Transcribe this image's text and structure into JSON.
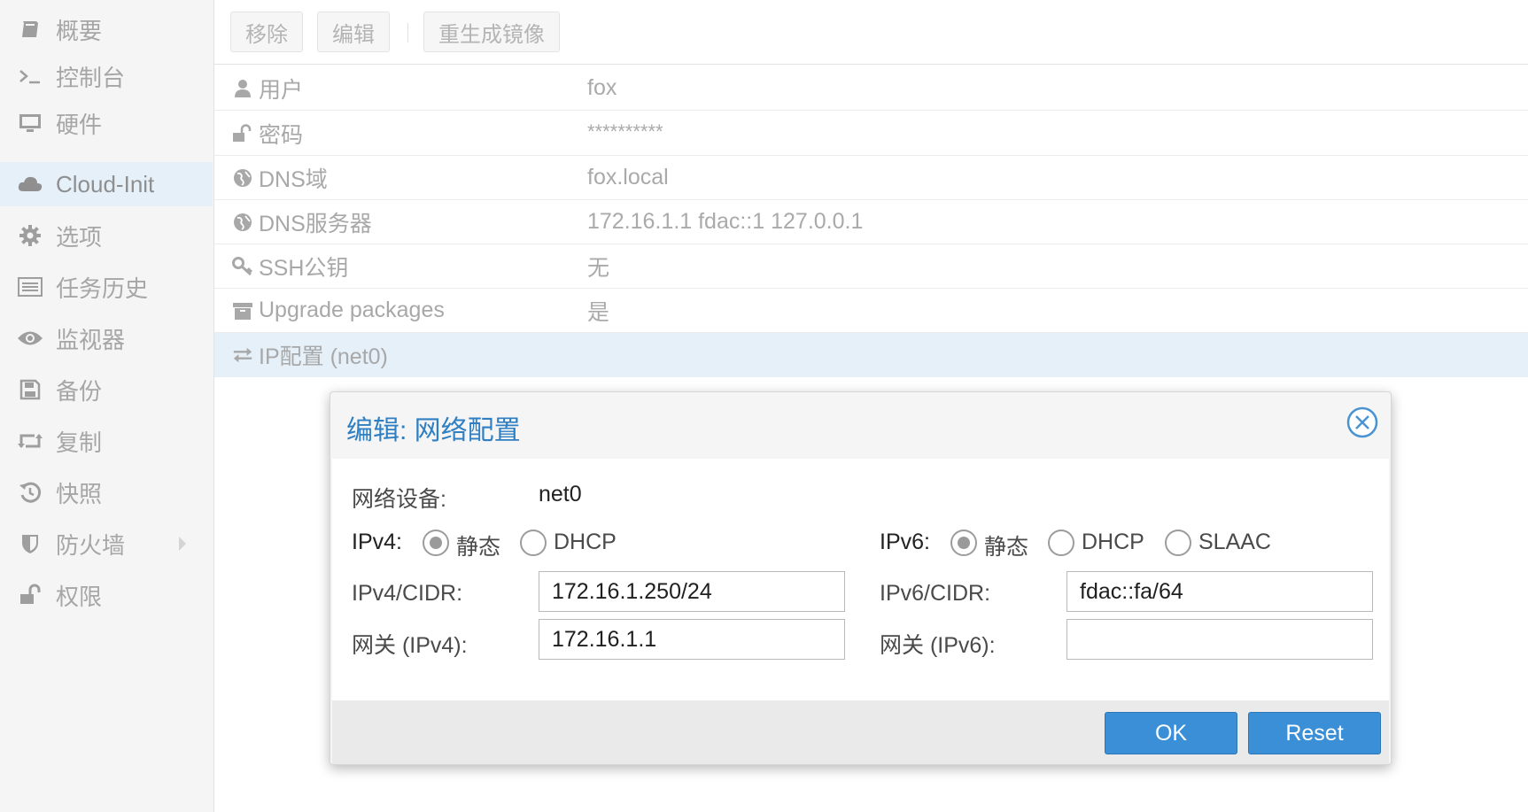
{
  "sidebar": {
    "items": [
      {
        "label": "概要",
        "icon": "book-icon"
      },
      {
        "label": "控制台",
        "icon": "terminal-icon"
      },
      {
        "label": "硬件",
        "icon": "monitor-icon"
      },
      {
        "label": "Cloud-Init",
        "icon": "cloud-icon",
        "active": true
      },
      {
        "label": "选项",
        "icon": "gear-icon"
      },
      {
        "label": "任务历史",
        "icon": "list-icon"
      },
      {
        "label": "监视器",
        "icon": "eye-icon"
      },
      {
        "label": "备份",
        "icon": "floppy-icon"
      },
      {
        "label": "复制",
        "icon": "retweet-icon"
      },
      {
        "label": "快照",
        "icon": "history-icon"
      },
      {
        "label": "防火墙",
        "icon": "shield-icon"
      },
      {
        "label": "权限",
        "icon": "unlock-icon"
      }
    ]
  },
  "toolbar": {
    "remove_label": "移除",
    "edit_label": "编辑",
    "regenerate_label": "重生成镜像"
  },
  "rows": [
    {
      "key": "用户",
      "value": "fox",
      "icon": "user-icon"
    },
    {
      "key": "密码",
      "value": "**********",
      "icon": "unlock-icon"
    },
    {
      "key": "DNS域",
      "value": "fox.local",
      "icon": "globe-icon"
    },
    {
      "key": "DNS服务器",
      "value": "172.16.1.1 fdac::1 127.0.0.1",
      "icon": "globe-icon"
    },
    {
      "key": "SSH公钥",
      "value": "无",
      "icon": "key-icon"
    },
    {
      "key": "Upgrade packages",
      "value": "是",
      "icon": "archive-icon"
    },
    {
      "key": "IP配置 (net0)",
      "value": "",
      "icon": "exchange-icon",
      "selected": true
    }
  ],
  "dialog": {
    "title": "编辑: 网络配置",
    "device_label": "网络设备:",
    "device_value": "net0",
    "ipv4_label": "IPv4:",
    "ipv4_options": [
      "静态",
      "DHCP"
    ],
    "ipv4_selected": "静态",
    "ipv6_label": "IPv6:",
    "ipv6_options": [
      "静态",
      "DHCP",
      "SLAAC"
    ],
    "ipv6_selected": "静态",
    "ipv4_cidr_label": "IPv4/CIDR:",
    "ipv4_cidr_value": "172.16.1.250/24",
    "ipv4_gw_label": "网关 (IPv4):",
    "ipv4_gw_value": "172.16.1.1",
    "ipv6_cidr_label": "IPv6/CIDR:",
    "ipv6_cidr_value": "fdac::fa/64",
    "ipv6_gw_label": "网关 (IPv6):",
    "ipv6_gw_value": "",
    "ok_label": "OK",
    "reset_label": "Reset"
  },
  "colors": {
    "accent": "#3a8fd6",
    "title_blue": "#2f7fc2",
    "selected_row": "#e6f0f9"
  }
}
